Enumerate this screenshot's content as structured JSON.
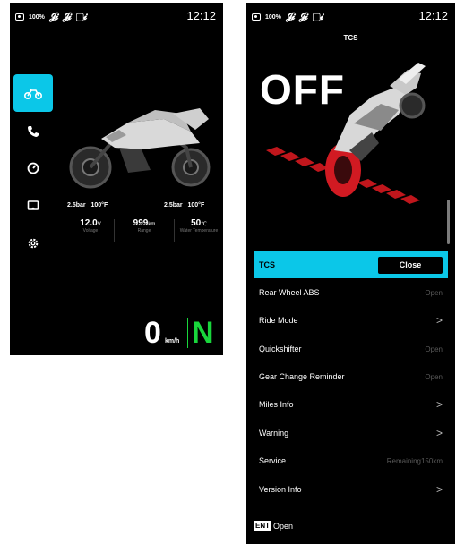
{
  "left": {
    "status": {
      "battery": "100%",
      "time": "12:12"
    },
    "sidebar": [
      "motorcycle-icon",
      "phone-icon",
      "gauge-icon",
      "display-icon",
      "settings-icon"
    ],
    "tires": {
      "front_pressure": "2.5bar",
      "front_temp": "100°F",
      "rear_pressure": "2.5bar",
      "rear_temp": "100°F"
    },
    "metrics": [
      {
        "value": "12.0",
        "unit": "V",
        "label": "Voltage"
      },
      {
        "value": "999",
        "unit": "km",
        "label": "Range"
      },
      {
        "value": "50",
        "unit": "℃",
        "label": "Water Temperature"
      }
    ],
    "speed": "0",
    "speed_unit": "km/h",
    "gear": "N",
    "colors": {
      "accent": "#0bc7e8",
      "gear": "#19d63c"
    }
  },
  "right": {
    "status": {
      "battery": "100%",
      "time": "12:12"
    },
    "title": "TCS",
    "state": "OFF",
    "menu": [
      {
        "label": "TCS",
        "value": "Close",
        "selected": true
      },
      {
        "label": "Rear Wheel ABS",
        "value": "Open"
      },
      {
        "label": "Ride Mode",
        "value": ">"
      },
      {
        "label": "Quickshifter",
        "value": "Open"
      },
      {
        "label": "Gear Change Reminder",
        "value": "Open"
      },
      {
        "label": "Miles Info",
        "value": ">"
      },
      {
        "label": "Warning",
        "value": ">"
      },
      {
        "label": "Service",
        "value": "Remaining150km"
      },
      {
        "label": "Version Info",
        "value": ">"
      }
    ],
    "footer": {
      "key": "ENT",
      "action": "Open"
    }
  }
}
